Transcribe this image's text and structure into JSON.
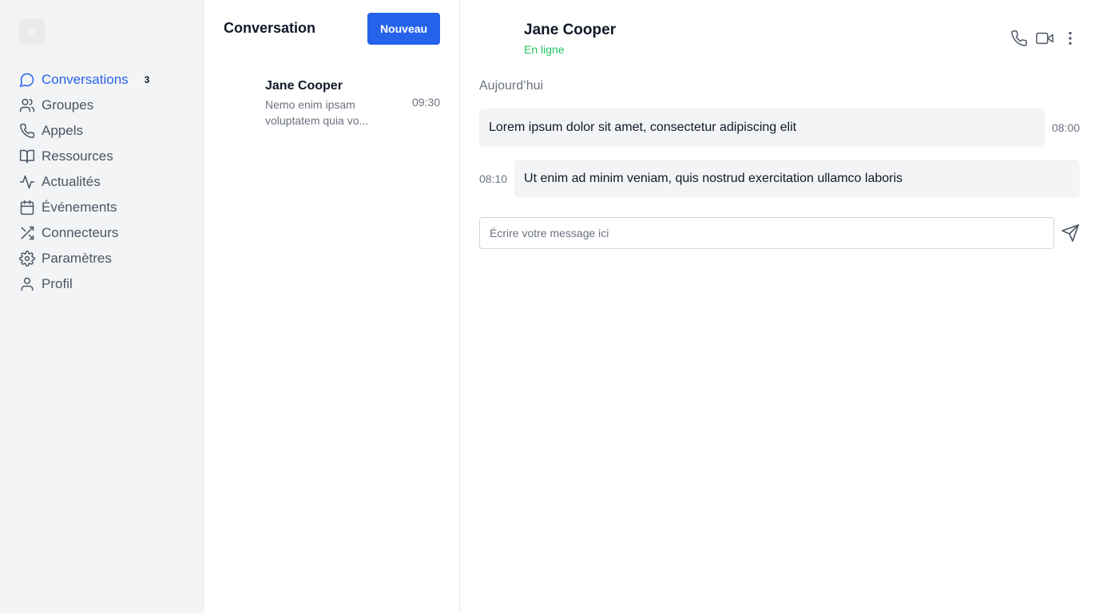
{
  "colors": {
    "accent": "#2563eb",
    "online": "#22c55e",
    "sidebar_bg": "#f3f4f6",
    "bubble_bg": "#f3f4f6"
  },
  "sidebar": {
    "items": [
      {
        "label": "Conversations",
        "icon": "chat-bubble-icon",
        "active": true,
        "badge": "3"
      },
      {
        "label": "Groupes",
        "icon": "users-icon"
      },
      {
        "label": "Appels",
        "icon": "phone-icon"
      },
      {
        "label": "Ressources",
        "icon": "book-open-icon"
      },
      {
        "label": "Actualités",
        "icon": "activity-icon"
      },
      {
        "label": "Événements",
        "icon": "calendar-icon"
      },
      {
        "label": "Connecteurs",
        "icon": "shuffle-icon"
      },
      {
        "label": "Paramètres",
        "icon": "gear-icon"
      },
      {
        "label": "Profil",
        "icon": "user-icon"
      }
    ]
  },
  "list": {
    "title": "Conversation",
    "new_button": "Nouveau",
    "conversations": [
      {
        "name": "Jane Cooper",
        "preview": "Nemo enim ipsam voluptatem quia vo...",
        "time": "09:30"
      }
    ]
  },
  "chat": {
    "contact_name": "Jane Cooper",
    "status": "En ligne",
    "day_label": "Aujourd’hui",
    "messages": [
      {
        "text": "Lorem ipsum dolor sit amet, consectetur adipiscing elit",
        "time": "08:00"
      },
      {
        "text": "Ut enim ad minim veniam, quis nostrud exercitation ullamco laboris",
        "time": "08:10"
      }
    ],
    "input_placeholder": "Écrire votre message ici",
    "input_value": "",
    "action_icons": [
      "phone-icon",
      "video-icon",
      "more-vertical-icon"
    ],
    "send_icon": "send-icon"
  }
}
